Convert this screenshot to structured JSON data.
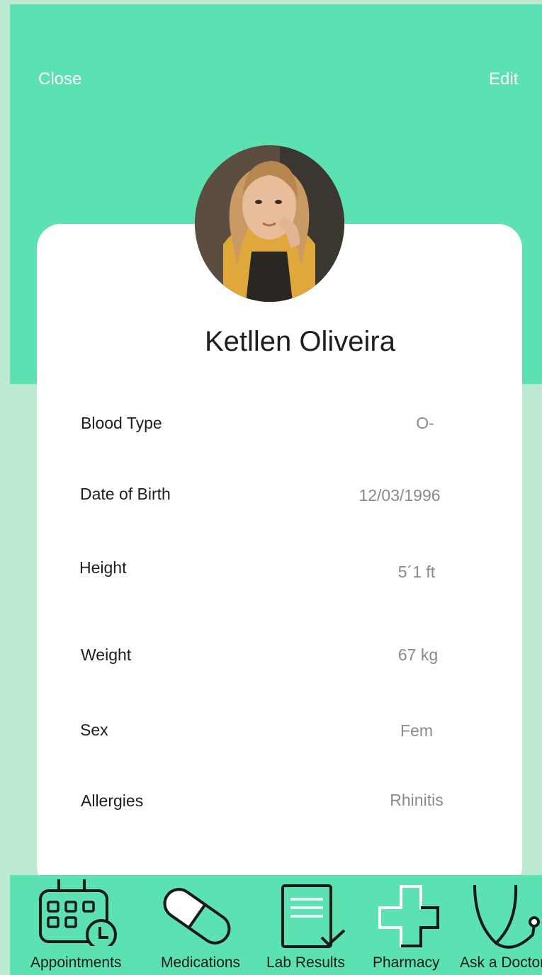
{
  "header": {
    "close_label": "Close",
    "edit_label": "Edit"
  },
  "profile": {
    "name": "Ketllen Oliveira"
  },
  "fields": [
    {
      "label": "Blood Type",
      "value": "O-"
    },
    {
      "label": "Date of Birth",
      "value": "12/03/1996"
    },
    {
      "label": "Height",
      "value": "5´1 ft"
    },
    {
      "label": "Weight",
      "value": "67 kg"
    },
    {
      "label": "Sex",
      "value": "Fem"
    },
    {
      "label": "Allergies",
      "value": "Rhinitis"
    }
  ],
  "nav": [
    {
      "label": "Appointments",
      "icon": "calendar-clock-icon"
    },
    {
      "label": "Medications",
      "icon": "pill-icon"
    },
    {
      "label": "Lab Results",
      "icon": "clipboard-check-icon"
    },
    {
      "label": "Pharmacy",
      "icon": "medical-cross-icon"
    },
    {
      "label": "Ask a Doctor",
      "icon": "stethoscope-icon"
    }
  ],
  "colors": {
    "accent": "#5ce1b2",
    "background": "#bcebd1",
    "card": "#ffffff",
    "value_text": "#8a8a8a"
  }
}
